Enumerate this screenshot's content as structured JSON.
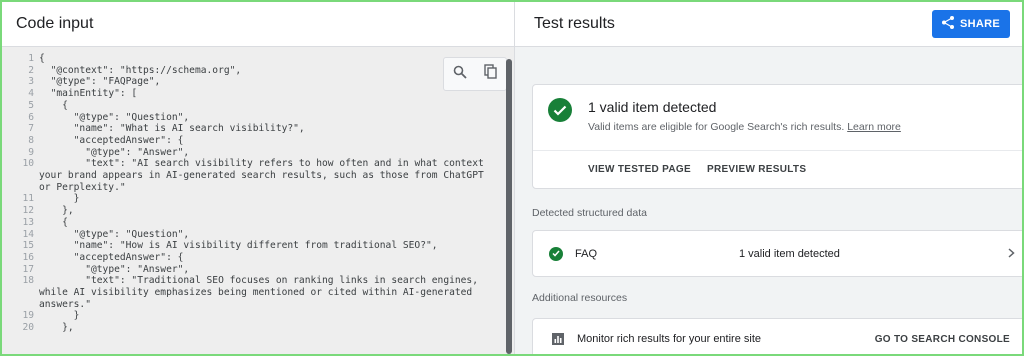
{
  "left_panel": {
    "title": "Code input",
    "code_lines": [
      {
        "n": "1",
        "text": "{"
      },
      {
        "n": "2",
        "text": "  \"@context\": \"https://schema.org\","
      },
      {
        "n": "3",
        "text": "  \"@type\": \"FAQPage\","
      },
      {
        "n": "4",
        "text": "  \"mainEntity\": ["
      },
      {
        "n": "5",
        "text": "    {"
      },
      {
        "n": "6",
        "text": "      \"@type\": \"Question\","
      },
      {
        "n": "7",
        "text": "      \"name\": \"What is AI search visibility?\","
      },
      {
        "n": "8",
        "text": "      \"acceptedAnswer\": {"
      },
      {
        "n": "9",
        "text": "        \"@type\": \"Answer\","
      },
      {
        "n": "10",
        "text": "        \"text\": \"AI search visibility refers to how often and in what context your brand appears in AI-generated search results, such as those from ChatGPT or Perplexity.\""
      },
      {
        "n": "11",
        "text": "      }"
      },
      {
        "n": "12",
        "text": "    },"
      },
      {
        "n": "13",
        "text": "    {"
      },
      {
        "n": "14",
        "text": "      \"@type\": \"Question\","
      },
      {
        "n": "15",
        "text": "      \"name\": \"How is AI visibility different from traditional SEO?\","
      },
      {
        "n": "16",
        "text": "      \"acceptedAnswer\": {"
      },
      {
        "n": "17",
        "text": "        \"@type\": \"Answer\","
      },
      {
        "n": "18",
        "text": "        \"text\": \"Traditional SEO focuses on ranking links in search engines, while AI visibility emphasizes being mentioned or cited within AI-generated answers.\""
      },
      {
        "n": "19",
        "text": "      }"
      },
      {
        "n": "20",
        "text": "    },"
      }
    ],
    "icons": [
      "search-icon",
      "copy-icon"
    ]
  },
  "right_panel": {
    "title": "Test results",
    "share_label": "SHARE",
    "summary": {
      "title": "1 valid item detected",
      "subtitle": "Valid items are eligible for Google Search's rich results.",
      "learn_more": "Learn more",
      "actions": [
        "VIEW TESTED PAGE",
        "PREVIEW RESULTS"
      ]
    },
    "detected_label": "Detected structured data",
    "faq_row": {
      "name": "FAQ",
      "count": "1 valid item detected"
    },
    "additional_label": "Additional resources",
    "resource_row": {
      "text": "Monitor rich results for your entire site",
      "link": "GO TO SEARCH CONSOLE"
    }
  },
  "colors": {
    "accent": "#1a73e8",
    "valid_green": "#188038",
    "frame_border": "#7ad97a"
  }
}
